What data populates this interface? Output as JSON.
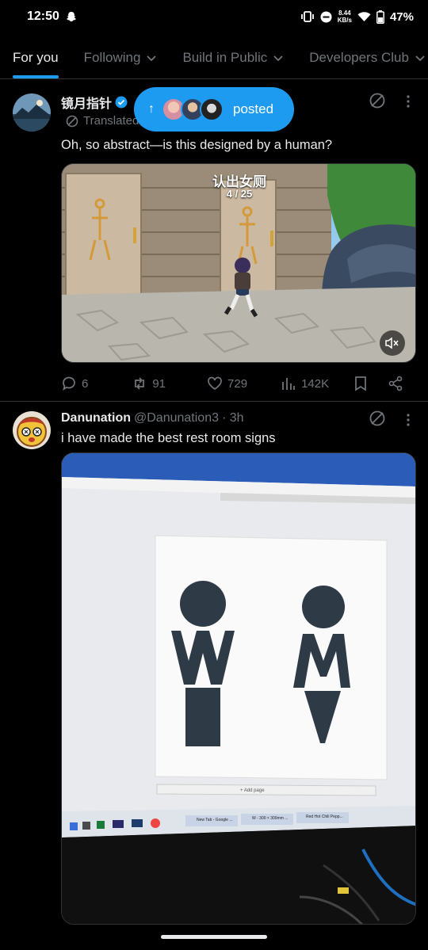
{
  "status_bar": {
    "time": "12:50",
    "net_speed_value": "8.44",
    "net_speed_unit": "KB/s",
    "battery": "47%"
  },
  "tabs": [
    {
      "label": "For you",
      "active": true
    },
    {
      "label": "Following",
      "has_dropdown": true
    },
    {
      "label": "Build in Public",
      "has_dropdown": true
    },
    {
      "label": "Developers Club",
      "has_dropdown": true
    }
  ],
  "posted_pill": {
    "label": "posted"
  },
  "tweets": [
    {
      "name": "镜月指针",
      "verified": true,
      "translated_label": "Translated",
      "text": "Oh, so abstract—is this designed by a human?",
      "video": {
        "caption_title": "认出女厕",
        "caption_progress": "4 / 25"
      },
      "stats": {
        "replies": "6",
        "reposts": "91",
        "likes": "729",
        "views": "142K"
      }
    },
    {
      "name": "Danunation",
      "handle": "@Danunation3",
      "time": "· 3h",
      "text": "i have made the best rest room signs",
      "photo": {
        "add_page": "+ Add page",
        "taskbar_tabs": [
          "New Tab - Google ...",
          "W - 300 × 300mm ...",
          "Red Hot Chili Pepp..."
        ]
      }
    }
  ],
  "colors": {
    "accent": "#1d9bf0",
    "background": "#000000",
    "muted": "#71767b",
    "text": "#e7e9ea"
  }
}
